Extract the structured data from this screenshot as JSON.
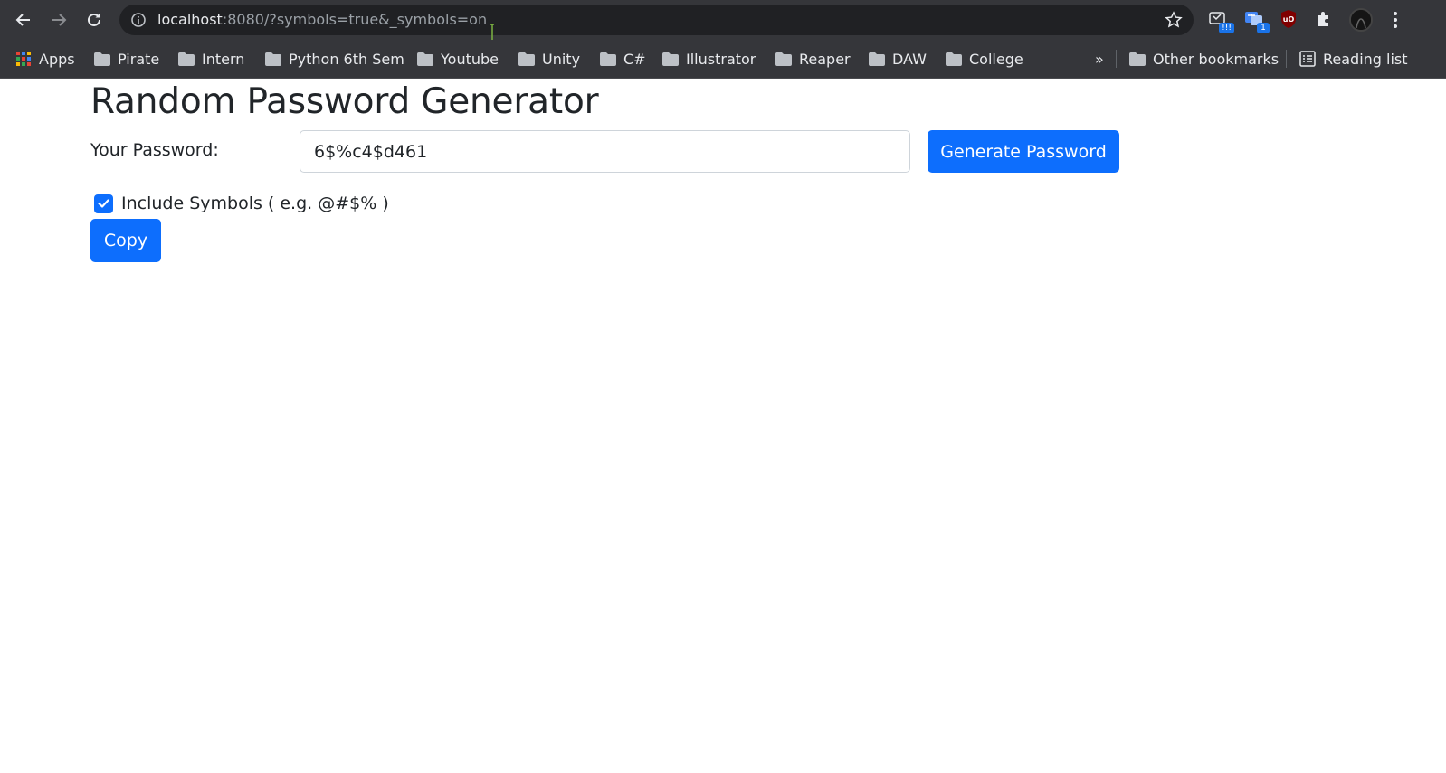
{
  "browser": {
    "url_host": "localhost",
    "url_rest": ":8080/?symbols=true&_symbols=on",
    "extension_badges": [
      "!!!",
      "1"
    ],
    "bookmarks": [
      {
        "label": "Apps",
        "icon": "apps-grid-icon"
      },
      {
        "label": "Pirate",
        "icon": "folder-icon"
      },
      {
        "label": "Intern",
        "icon": "folder-icon"
      },
      {
        "label": "Python 6th Sem",
        "icon": "folder-icon"
      },
      {
        "label": "Youtube",
        "icon": "folder-icon"
      },
      {
        "label": "Unity",
        "icon": "folder-icon"
      },
      {
        "label": "C#",
        "icon": "folder-icon"
      },
      {
        "label": "Illustrator",
        "icon": "folder-icon"
      },
      {
        "label": "Reaper",
        "icon": "folder-icon"
      },
      {
        "label": "DAW",
        "icon": "folder-icon"
      },
      {
        "label": "College",
        "icon": "folder-icon"
      }
    ],
    "overflow_label": "»",
    "other_bookmarks": "Other bookmarks",
    "reading_list": "Reading list"
  },
  "app": {
    "title": "Random Password Generator",
    "password_label": "Your Password:",
    "password_value": "6$%c4$d461",
    "generate_label": "Generate Password",
    "include_symbols_label": "Include Symbols ( e.g. @#$% )",
    "include_symbols_checked": true,
    "copy_label": "Copy"
  },
  "colors": {
    "primary": "#0d6efd",
    "chrome_bg": "#35363a",
    "omnibox_bg": "#202124",
    "text": "#212529"
  }
}
